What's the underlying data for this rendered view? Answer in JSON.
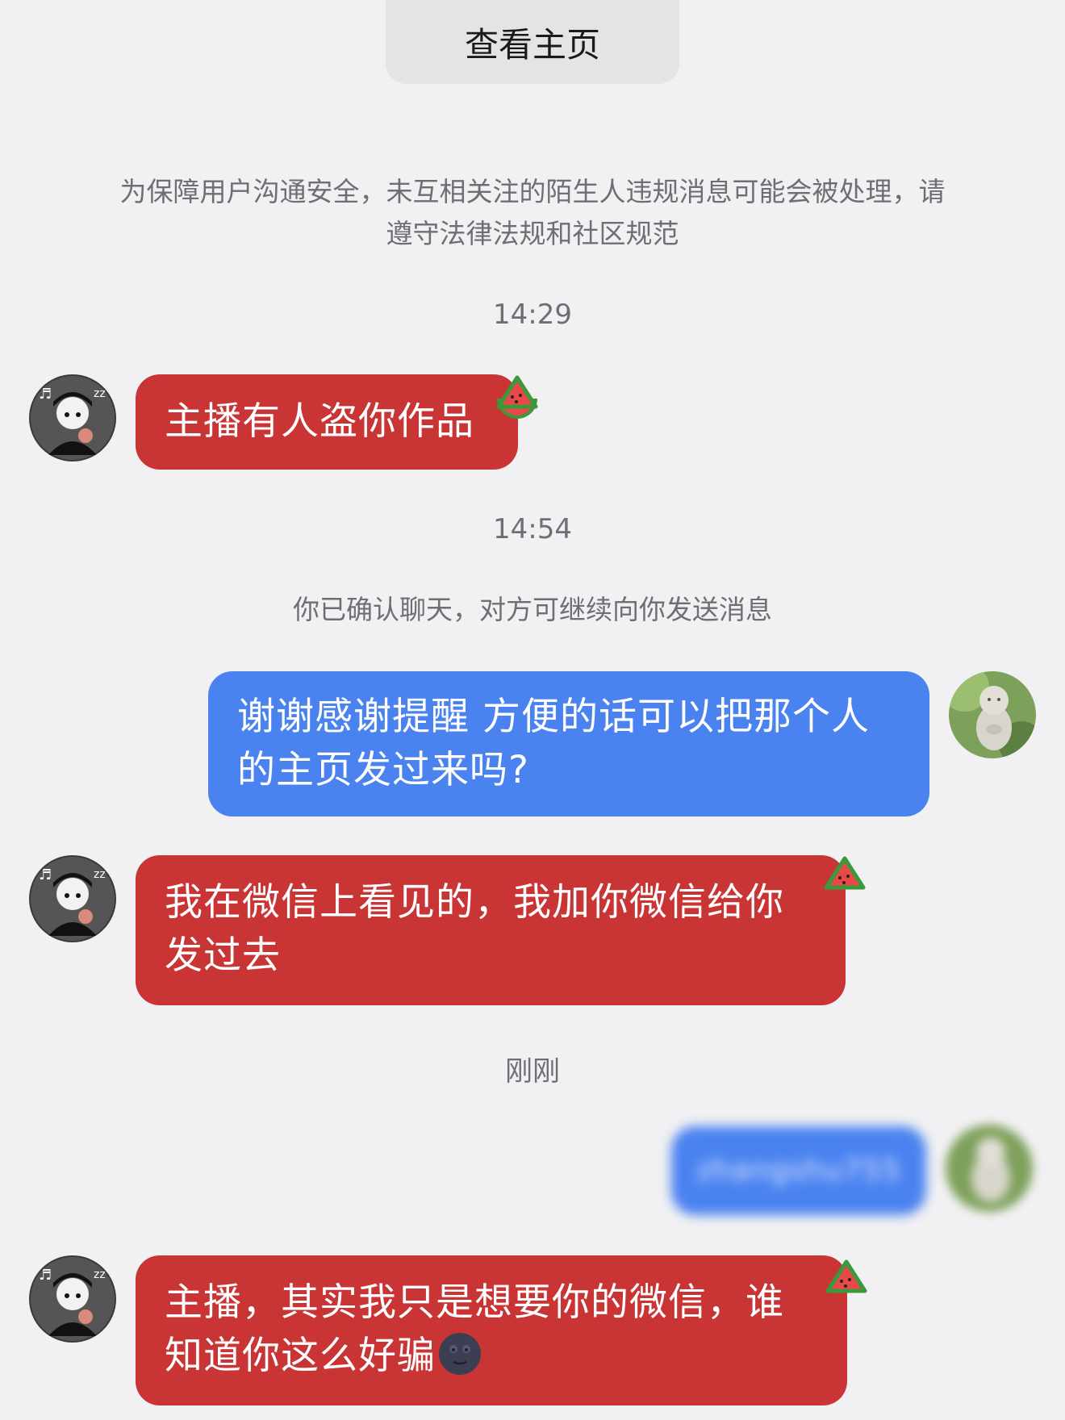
{
  "header": {
    "view_profile_label": "查看主页"
  },
  "notices": {
    "safety_notice": "为保障用户沟通安全，未互相关注的陌生人违规消息可能会被处理，请遵守法律法规和社区规范",
    "confirmed_chat": "你已确认聊天，对方可继续向你发送消息"
  },
  "timestamps": {
    "t1": "14:29",
    "t2": "14:54",
    "t3": "刚刚"
  },
  "messages": [
    {
      "sender": "other",
      "text": "主播有人盗你作品",
      "badge_icon": "watermelon-icon"
    },
    {
      "sender": "self",
      "text": "谢谢感谢提醒 方便的话可以把那个人的主页发过来吗?"
    },
    {
      "sender": "other",
      "text": "我在微信上看见的，我加你微信给你发过去",
      "badge_icon": "watermelon-icon"
    },
    {
      "sender": "self",
      "text": "zhangshu755",
      "blurred": true
    },
    {
      "sender": "other",
      "text": "主播，其实我只是想要你的微信，谁知道你这么好骗",
      "badge_icon": "watermelon-icon",
      "trailing_icon": "new-moon-face-icon"
    }
  ],
  "colors": {
    "background": "#f1f1f3",
    "other_bubble": "#c93434",
    "self_bubble": "#4a82f0",
    "system_text": "#6f6f73"
  }
}
